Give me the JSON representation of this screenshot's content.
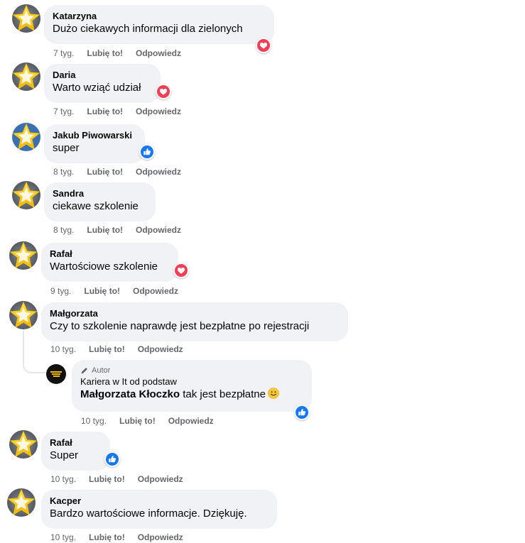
{
  "labels": {
    "like": "Lubię to!",
    "reply": "Odpowiedz"
  },
  "colors": {
    "bubble": "#f0f2f5",
    "meta": "#65676b",
    "like_blue": "#1877f2",
    "love_red": "#f33e58"
  },
  "comments": [
    {
      "author": "Katarzyna",
      "text": "Dużo ciekawych informacji dla zielonych",
      "time": "7 tyg.",
      "reaction": "love-icon"
    },
    {
      "author": "Daria",
      "text": "Warto wziąć udział",
      "time": "7 tyg.",
      "reaction": "love-icon"
    },
    {
      "author": "Jakub Piwowarski",
      "text": "super",
      "time": "8 tyg.",
      "reaction": "like-icon"
    },
    {
      "author": "Sandra",
      "text": "ciekawe szkolenie",
      "time": "8 tyg.",
      "reaction": ""
    },
    {
      "author": "Rafał",
      "text": "Wartościowe szkolenie",
      "time": "9 tyg.",
      "reaction": "love-icon"
    },
    {
      "author": "Małgorzata",
      "text": "Czy to szkolenie naprawdę jest bezpłatne po rejestracji",
      "time": "10 tyg.",
      "reaction": ""
    },
    {
      "author": "Rafał",
      "text": "Super",
      "time": "10 tyg.",
      "reaction": "like-icon"
    },
    {
      "author": "Kacper",
      "text": "Bardzo wartościowe informacje. Dziękuję.",
      "time": "10 tyg.",
      "reaction": ""
    }
  ],
  "reply": {
    "badge": "Autor",
    "author": "Kariera w It od podstaw",
    "mention": "Małgorzata Kłoczko",
    "text": "tak jest bezpłatne",
    "emoji": "smile-emoji",
    "time": "10 tyg.",
    "reaction": "like-icon"
  }
}
